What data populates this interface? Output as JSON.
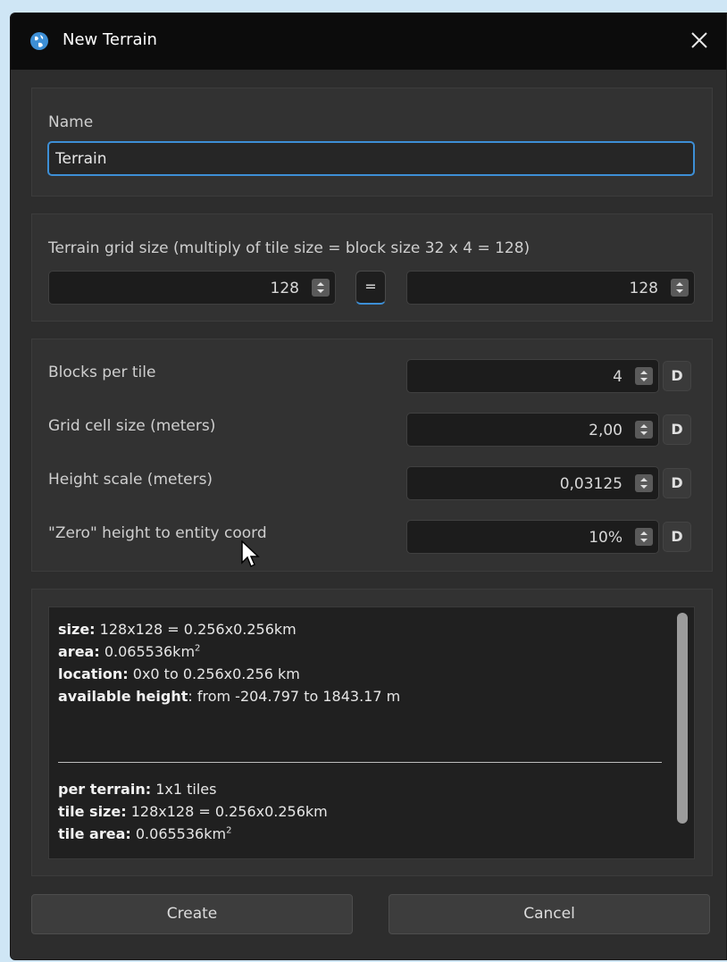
{
  "window": {
    "title": "New Terrain",
    "icon": "globe-icon",
    "close_icon": "close-icon"
  },
  "name_section": {
    "label": "Name",
    "value": "Terrain"
  },
  "grid_section": {
    "label": "Terrain grid size (multiply of tile size = block size 32 x 4 = 128)",
    "width_value": "128",
    "link_label": "=",
    "height_value": "128"
  },
  "params_section": {
    "rows": [
      {
        "label": "Blocks per tile",
        "value": "4",
        "default_label": "D"
      },
      {
        "label": "Grid cell size (meters)",
        "value": "2,00",
        "default_label": "D"
      },
      {
        "label": "Height scale (meters)",
        "value": "0,03125",
        "default_label": "D"
      },
      {
        "label": "\"Zero\" height to entity coord",
        "value": "10%",
        "default_label": "D"
      }
    ]
  },
  "info": {
    "size_key": "size:",
    "size_val": "128x128 = 0.256x0.256km",
    "area_key": "area:",
    "area_val": "0.065536km",
    "area_sup": "2",
    "location_key": "location:",
    "location_val": "0x0 to 0.256x0.256 km",
    "height_key": "available height",
    "height_val": ": from -204.797 to 1843.17 m",
    "per_terrain_key": "per terrain:",
    "per_terrain_val": "1x1 tiles",
    "tile_size_key": "tile size:",
    "tile_size_val": "128x128 = 0.256x0.256km",
    "tile_area_key": "tile area:",
    "tile_area_val": "0.065536km",
    "tile_area_sup": "2"
  },
  "buttons": {
    "create": "Create",
    "cancel": "Cancel"
  },
  "colors": {
    "accent": "#3d8fd6",
    "background": "#2d2d2d",
    "titlebar": "#0c0c0c"
  }
}
